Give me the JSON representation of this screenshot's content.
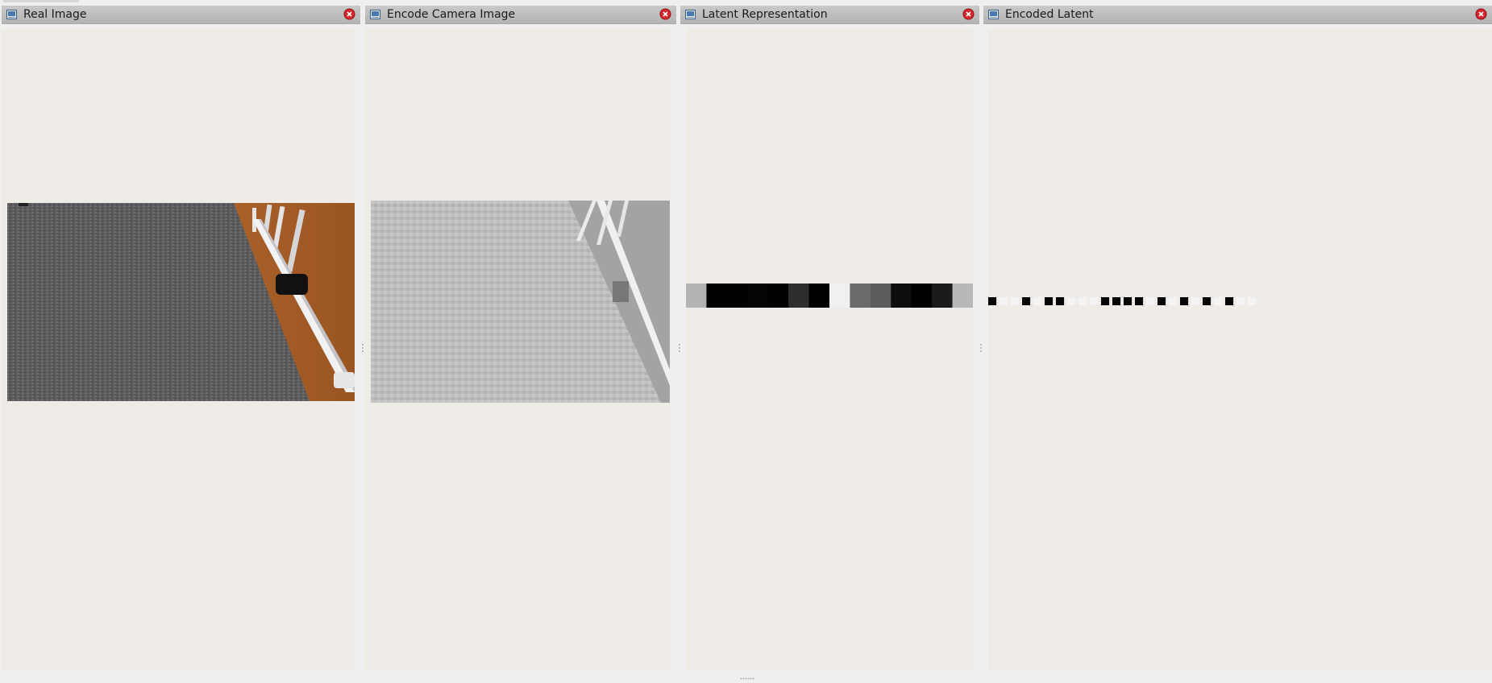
{
  "panels": [
    {
      "id": "real",
      "title": "Real Image",
      "image_description_icon": "camera-feed"
    },
    {
      "id": "encode",
      "title": "Encode Camera Image",
      "image_description_icon": "grayscale-feed"
    },
    {
      "id": "latent",
      "title": "Latent Representation",
      "image_description_icon": "latent-strip"
    },
    {
      "id": "encoded",
      "title": "Encoded Latent",
      "image_description_icon": "encoded-strip"
    }
  ],
  "latent_cells": [
    0.7,
    0.0,
    0.0,
    0.02,
    0.0,
    0.18,
    0.0,
    0.94,
    0.42,
    0.36,
    0.05,
    0.0,
    0.1,
    0.72
  ],
  "encoded_cells": [
    1,
    0,
    0,
    1,
    0,
    1,
    1,
    0,
    0,
    0,
    1,
    1,
    1,
    1,
    0,
    1,
    0,
    1,
    0,
    1,
    0,
    1,
    0,
    0
  ],
  "icons": {
    "window": "image-view-icon",
    "close": "close-icon"
  },
  "colors": {
    "close_red": "#d9252b",
    "titlebar": "#b8b8b8",
    "view_bg": "#efebe6"
  }
}
